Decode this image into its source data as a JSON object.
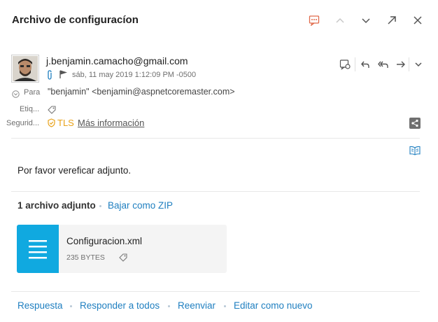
{
  "header": {
    "title": "Archivo de configuracíon",
    "icons": [
      "reminder-icon",
      "arrow-up-icon",
      "arrow-down-icon",
      "pop-out-icon",
      "close-icon"
    ]
  },
  "message": {
    "sender_email": "j.benjamin.camacho@gmail.com",
    "date": "sáb, 11 may 2019 1:12:09 PM -0500",
    "to_label": "Para",
    "to_value": "\"benjamin\" <benjamin@aspnetcoremaster.com>",
    "tags_label": "Etiq...",
    "security_label": "Segurid...",
    "security_protocol": "TLS",
    "security_more": "Más información",
    "body": "Por favor vereficar adjunto.",
    "accent_colors": {
      "link": "#1f7fc0",
      "tls": "#e8a21a",
      "file_tile": "#10a9e0"
    }
  },
  "attachments": {
    "count_label": "1 archivo adjunto",
    "download_zip": "Bajar como ZIP",
    "files": [
      {
        "name": "Configuracion.xml",
        "size": "235 BYTES"
      }
    ]
  },
  "actions": {
    "reply": "Respuesta",
    "reply_all": "Responder a todos",
    "forward": "Reenviar",
    "edit_as_new": "Editar como nuevo"
  }
}
